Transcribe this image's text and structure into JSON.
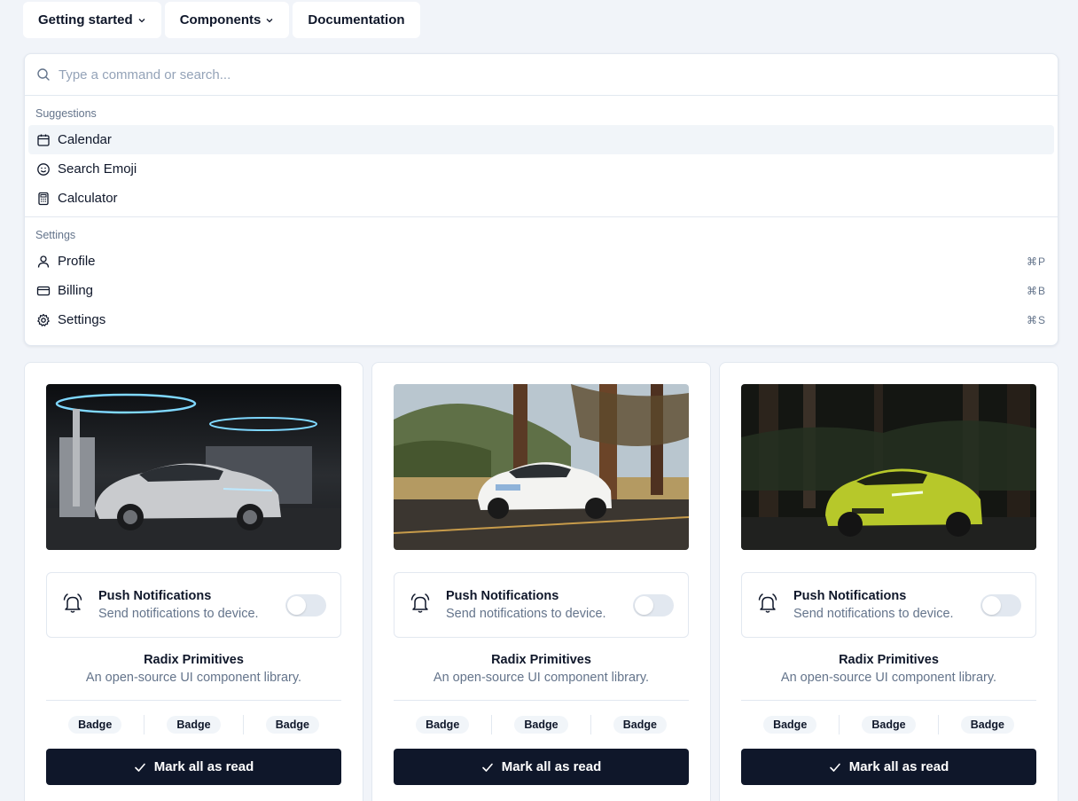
{
  "nav": {
    "items": [
      {
        "label": "Getting started",
        "has_menu": true
      },
      {
        "label": "Components",
        "has_menu": true
      },
      {
        "label": "Documentation",
        "has_menu": false
      }
    ]
  },
  "command": {
    "placeholder": "Type a command or search...",
    "groups": [
      {
        "heading": "Suggestions",
        "items": [
          {
            "label": "Calendar",
            "icon": "calendar-icon",
            "shortcut": "",
            "active": true
          },
          {
            "label": "Search Emoji",
            "icon": "smile-icon",
            "shortcut": ""
          },
          {
            "label": "Calculator",
            "icon": "calculator-icon",
            "shortcut": ""
          }
        ]
      },
      {
        "heading": "Settings",
        "items": [
          {
            "label": "Profile",
            "icon": "user-icon",
            "shortcut": "⌘P"
          },
          {
            "label": "Billing",
            "icon": "credit-card-icon",
            "shortcut": "⌘B"
          },
          {
            "label": "Settings",
            "icon": "gear-icon",
            "shortcut": "⌘S"
          }
        ]
      }
    ]
  },
  "cards": [
    {
      "image": "white-suv-charging-station-photo",
      "notif_title": "Push Notifications",
      "notif_desc": "Send notifications to device.",
      "toggle_on": false,
      "lib_name": "Radix Primitives",
      "lib_desc": "An open-source UI component library.",
      "badges": [
        "Badge",
        "Badge",
        "Badge"
      ],
      "button": "Mark all as read"
    },
    {
      "image": "white-suv-forest-road-photo",
      "notif_title": "Push Notifications",
      "notif_desc": "Send notifications to device.",
      "toggle_on": false,
      "lib_name": "Radix Primitives",
      "lib_desc": "An open-source UI component library.",
      "badges": [
        "Badge",
        "Badge",
        "Badge"
      ],
      "button": "Mark all as read"
    },
    {
      "image": "lime-suv-dark-forest-photo",
      "notif_title": "Push Notifications",
      "notif_desc": "Send notifications to device.",
      "toggle_on": false,
      "lib_name": "Radix Primitives",
      "lib_desc": "An open-source UI component library.",
      "badges": [
        "Badge",
        "Badge",
        "Badge"
      ],
      "button": "Mark all as read"
    }
  ],
  "colors": {
    "background": "#f1f4f9",
    "primary": "#0f172a",
    "muted": "#64748b",
    "border": "#e2e8f0"
  }
}
